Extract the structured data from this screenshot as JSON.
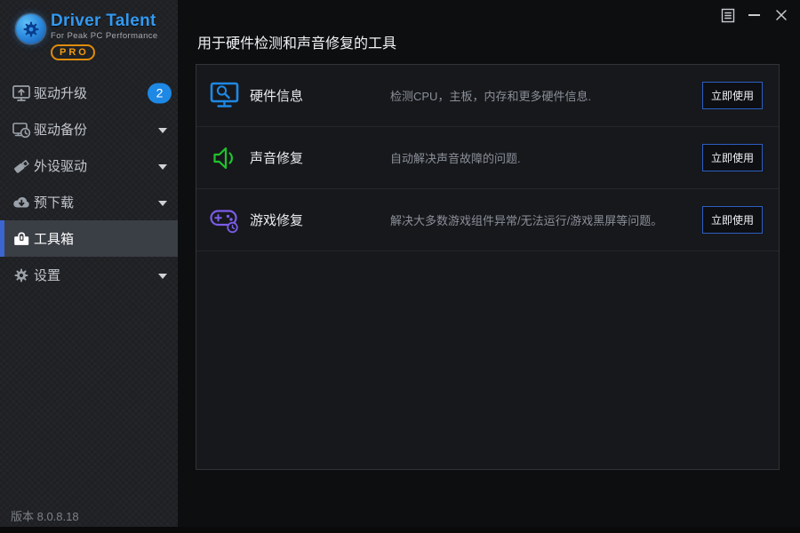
{
  "app": {
    "brand": "Driver Talent",
    "tagline": "For Peak PC Performance",
    "edition": "PRO",
    "version": "版本 8.0.8.18"
  },
  "window_controls": {
    "icons": [
      "menu-icon",
      "minimize-icon",
      "close-icon"
    ]
  },
  "sidebar": {
    "items": [
      {
        "label": "驱动升级",
        "icon": "monitor-upgrade-icon",
        "badge": "2",
        "selected": false
      },
      {
        "label": "驱动备份",
        "icon": "monitor-backup-icon",
        "caret": true,
        "selected": false
      },
      {
        "label": "外设驱动",
        "icon": "usb-drive-icon",
        "caret": true,
        "selected": false
      },
      {
        "label": "预下载",
        "icon": "cloud-download-icon",
        "caret": true,
        "selected": false
      },
      {
        "label": "工具箱",
        "icon": "toolbox-icon",
        "selected": true
      },
      {
        "label": "设置",
        "icon": "gear-icon",
        "caret": true,
        "selected": false
      }
    ]
  },
  "main": {
    "title": "用于硬件检测和声音修复的工具",
    "tools": [
      {
        "name": "硬件信息",
        "icon": "hardware-info-icon",
        "icon_color": "#1e88e5",
        "desc": "检测CPU，主板，内存和更多硬件信息.",
        "button": "立即使用"
      },
      {
        "name": "声音修复",
        "icon": "sound-repair-icon",
        "icon_color": "#1ec42c",
        "desc": "自动解决声音故障的问题.",
        "button": "立即使用"
      },
      {
        "name": "游戏修复",
        "icon": "game-repair-icon",
        "icon_color": "#7b5ce8",
        "desc": "解决大多数游戏组件异常/无法运行/游戏黑屏等问题。",
        "button": "立即使用"
      }
    ]
  },
  "colors": {
    "accent_blue": "#1e88e5",
    "selected_bar": "#3c66cf",
    "badge_blue": "#1e88e5",
    "pro_orange": "#f09a10",
    "hardware_icon": "#1e88e5",
    "sound_icon": "#1ec42c",
    "game_icon": "#7b5ce8",
    "sidebar_bg": "#1e2024",
    "card_bg": "#17181b",
    "main_bg": "#0d0e10"
  }
}
